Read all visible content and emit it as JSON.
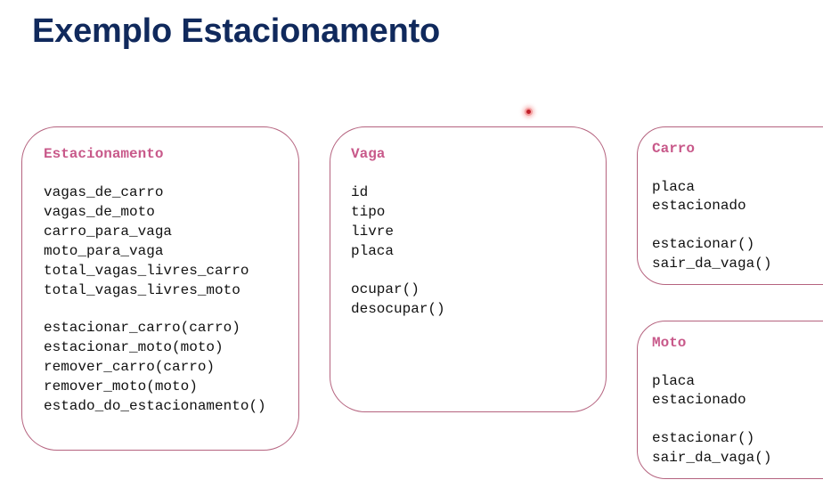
{
  "slide": {
    "title": "Exemplo Estacionamento"
  },
  "classes": {
    "estacionamento": {
      "name": "Estacionamento",
      "attributes": [
        "vagas_de_carro",
        "vagas_de_moto",
        "carro_para_vaga",
        "moto_para_vaga",
        "total_vagas_livres_carro",
        "total_vagas_livres_moto"
      ],
      "methods": [
        "estacionar_carro(carro)",
        "estacionar_moto(moto)",
        "remover_carro(carro)",
        "remover_moto(moto)",
        "estado_do_estacionamento()"
      ]
    },
    "vaga": {
      "name": "Vaga",
      "attributes": [
        "id",
        "tipo",
        "livre",
        "placa"
      ],
      "methods": [
        "ocupar()",
        "desocupar()"
      ]
    },
    "carro": {
      "name": "Carro",
      "attributes": [
        "placa",
        "estacionado"
      ],
      "methods": [
        "estacionar()",
        "sair_da_vaga()"
      ]
    },
    "moto": {
      "name": "Moto",
      "attributes": [
        "placa",
        "estacionado"
      ],
      "methods": [
        "estacionar()",
        "sair_da_vaga()"
      ]
    }
  },
  "colors": {
    "title": "#10295c",
    "class_name": "#c8598a",
    "border": "#b5637f"
  }
}
